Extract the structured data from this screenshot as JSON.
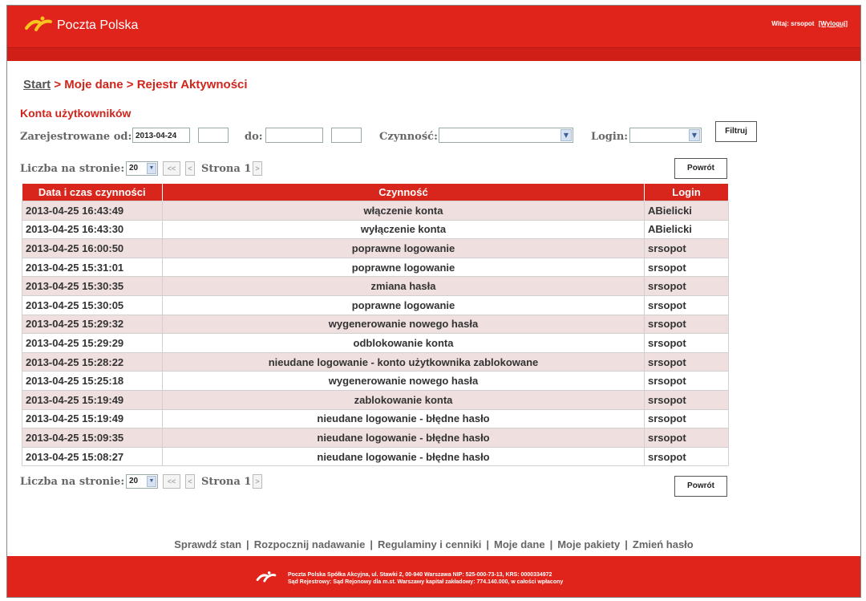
{
  "header": {
    "brand": "Poczta Polska",
    "welcome": "Witaj: srsopot",
    "logout": "[Wyloguj]"
  },
  "breadcrumb": {
    "start": "Start",
    "rest": " > Moje dane > Rejestr Aktywności"
  },
  "section_title": "Konta użytkowników",
  "filters": {
    "registered_from_label": "Zarejestrowane od:",
    "date_from": "2013-04-24",
    "time_from": "",
    "to_label": "do:",
    "date_to": "",
    "time_to": "",
    "action_label": "Czynność:",
    "action_value": "",
    "login_label": "Login:",
    "login_value": "",
    "filter_button": "Filtruj"
  },
  "pager": {
    "per_page_label": "Liczba na stronie:",
    "per_page_value": "20",
    "first": "<<",
    "prev": "<",
    "page_label": "Strona 1",
    "next": ">",
    "back_button": "Powrót"
  },
  "table": {
    "columns": [
      "Data i czas czynności",
      "Czynność",
      "Login"
    ],
    "rows": [
      [
        "2013-04-25 16:43:49",
        "włączenie konta",
        "ABielicki"
      ],
      [
        "2013-04-25 16:43:30",
        "wyłączenie konta",
        "ABielicki"
      ],
      [
        "2013-04-25 16:00:50",
        "poprawne logowanie",
        "srsopot"
      ],
      [
        "2013-04-25 15:31:01",
        "poprawne logowanie",
        "srsopot"
      ],
      [
        "2013-04-25 15:30:35",
        "zmiana hasła",
        "srsopot"
      ],
      [
        "2013-04-25 15:30:05",
        "poprawne logowanie",
        "srsopot"
      ],
      [
        "2013-04-25 15:29:32",
        "wygenerowanie nowego hasła",
        "srsopot"
      ],
      [
        "2013-04-25 15:29:29",
        "odblokowanie konta",
        "srsopot"
      ],
      [
        "2013-04-25 15:28:22",
        "nieudane logowanie - konto użytkownika zablokowane",
        "srsopot"
      ],
      [
        "2013-04-25 15:25:18",
        "wygenerowanie nowego hasła",
        "srsopot"
      ],
      [
        "2013-04-25 15:19:49",
        "zablokowanie konta",
        "srsopot"
      ],
      [
        "2013-04-25 15:19:49",
        "nieudane logowanie - błędne hasło",
        "srsopot"
      ],
      [
        "2013-04-25 15:09:35",
        "nieudane logowanie - błędne hasło",
        "srsopot"
      ],
      [
        "2013-04-25 15:08:27",
        "nieudane logowanie - błędne hasło",
        "srsopot"
      ]
    ]
  },
  "footer_links": [
    "Sprawdź stan",
    "Rozpocznij nadawanie",
    "Regulaminy i cenniki",
    "Moje dane",
    "Moje pakiety",
    "Zmień hasło"
  ],
  "footer": {
    "line1": "Poczta Polska Spółka Akcyjna, ul. Stawki 2, 00-940 Warszawa NIP: 525-000-73-13, KRS: 0000334972",
    "line2": "Sąd Rejestrowy: Sąd Rejonowy dla m.st. Warszawy kapitał zakładowy: 774.140.000, w całości wpłacony"
  },
  "colors": {
    "brand_red": "#e0241b",
    "row_alt": "#efdfdf"
  },
  "icons": [
    "poczta-polska-logo-icon",
    "chevron-down-icon"
  ]
}
